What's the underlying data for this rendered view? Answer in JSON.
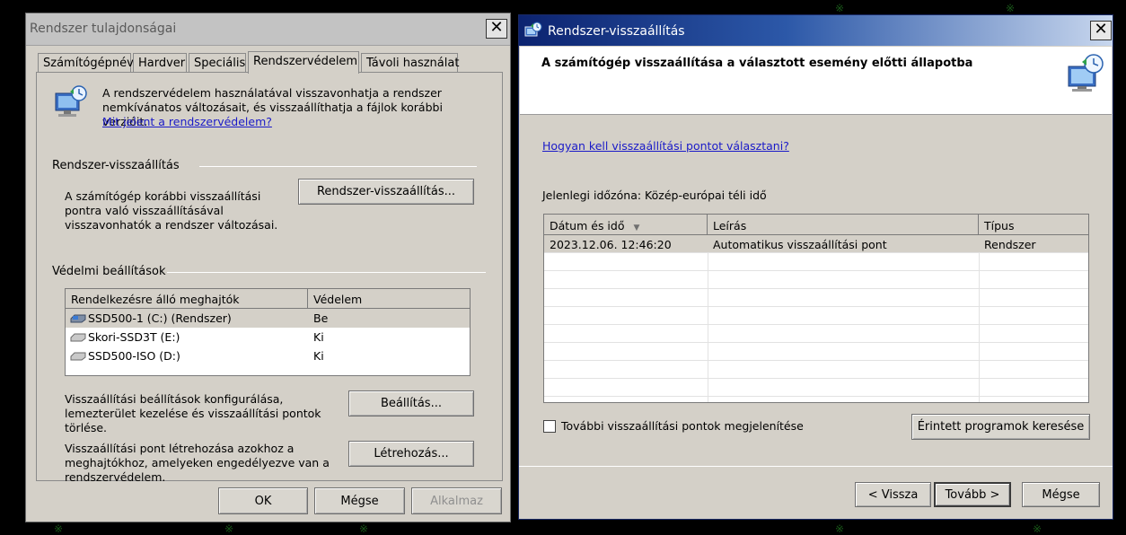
{
  "background": {
    "glyphs": [
      "※",
      "※",
      "※",
      "※",
      "※",
      "※",
      "※"
    ]
  },
  "sys_props": {
    "title": "Rendszer tulajdonságai",
    "close_glyph": "✕",
    "tabs": [
      "Számítógépnév",
      "Hardver",
      "Speciális",
      "Rendszervédelem",
      "Távoli használat"
    ],
    "active_tab": "Rendszervédelem",
    "intro_text": "A rendszervédelem használatával visszavonhatja a rendszer nemkívánatos változásait, és visszaállíthatja a fájlok korábbi verzióit.",
    "intro_link": "Mit jelent a rendszervédelem?",
    "restore_group": {
      "title": "Rendszer-visszaállítás",
      "text": "A számítógép korábbi visszaállítási pontra való visszaállításával visszavonhatók a rendszer változásai.",
      "button": "Rendszer-visszaállítás..."
    },
    "protection_group": {
      "title": "Védelmi beállítások",
      "columns": [
        "Rendelkezésre álló meghajtók",
        "Védelem"
      ],
      "drives": [
        {
          "name": "SSD500-1 (C:) (Rendszer)",
          "protection": "Be",
          "icon": "system-drive-icon",
          "selected": true
        },
        {
          "name": "Skori-SSD3T (E:)",
          "protection": "Ki",
          "icon": "drive-icon",
          "selected": false
        },
        {
          "name": "SSD500-ISO (D:)",
          "protection": "Ki",
          "icon": "drive-icon",
          "selected": false
        }
      ],
      "configure_text": "Visszaállítási beállítások konfigurálása, lemezterület kezelése és visszaállítási pontok törlése.",
      "configure_button": "Beállítás...",
      "create_text": "Visszaállítási pont létrehozása azokhoz a meghajtókhoz, amelyeken engedélyezve van a rendszervédelem.",
      "create_button": "Létrehozás..."
    },
    "buttons": {
      "ok": "OK",
      "cancel": "Mégse",
      "apply": "Alkalmaz"
    }
  },
  "sys_restore": {
    "title": "Rendszer-visszaállítás",
    "close_glyph": "✕",
    "header_title": "A számítógép visszaállítása a választott esemény előtti állapotba",
    "help_link": "Hogyan kell visszaállítási pontot választani?",
    "timezone_text": "Jelenlegi időzóna: Közép-európai téli idő",
    "columns": [
      "Dátum és idő",
      "Leírás",
      "Típus"
    ],
    "sort_glyph": "▼",
    "rows": [
      {
        "date": "2023.12.06. 12:46:20",
        "description": "Automatikus visszaállítási pont",
        "type": "Rendszer",
        "selected": true
      }
    ],
    "show_more_label": "További visszaállítási pontok megjelenítése",
    "show_more_checked": false,
    "scan_button": "Érintett programok keresése",
    "buttons": {
      "back": "< Vissza",
      "next": "Tovább >",
      "cancel": "Mégse"
    }
  },
  "colors": {
    "dialog_bg": "#d4d0c8",
    "link": "#1a1ac8",
    "titlebar_gradient_start": "#0c2370",
    "titlebar_gradient_end": "#c8d7ee"
  }
}
